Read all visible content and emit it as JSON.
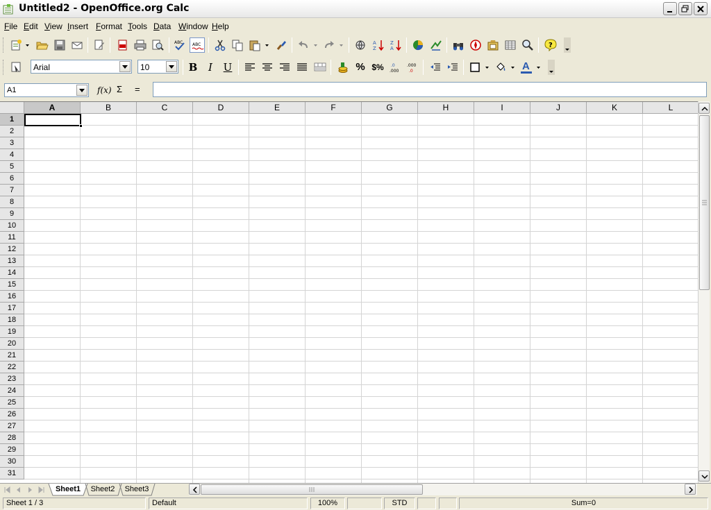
{
  "window": {
    "title": "Untitled2 - OpenOffice.org Calc"
  },
  "menu": [
    {
      "u": "F",
      "rest": "ile"
    },
    {
      "u": "E",
      "rest": "dit"
    },
    {
      "u": "V",
      "rest": "iew"
    },
    {
      "u": "I",
      "rest": "nsert"
    },
    {
      "u": "F",
      "rest": "ormat"
    },
    {
      "u": "T",
      "rest": "ools"
    },
    {
      "u": "D",
      "rest": "ata"
    },
    {
      "u": "W",
      "rest": "indow"
    },
    {
      "u": "H",
      "rest": "elp"
    }
  ],
  "format_toolbar": {
    "font_name": "Arial",
    "font_size": "10",
    "bold": "B",
    "italic": "I",
    "underline": "U",
    "percent": "%",
    "currency": "$%",
    "font_color_letter": "A"
  },
  "formula_bar": {
    "cell_ref": "A1",
    "function_label": "f(x)",
    "sum_label": "Σ",
    "equals_label": "=",
    "formula": ""
  },
  "grid": {
    "columns": [
      "A",
      "B",
      "C",
      "D",
      "E",
      "F",
      "G",
      "H",
      "I",
      "J",
      "K",
      "L"
    ],
    "rows": [
      "1",
      "2",
      "3",
      "4",
      "5",
      "6",
      "7",
      "8",
      "9",
      "10",
      "11",
      "12",
      "13",
      "14",
      "15",
      "16",
      "17",
      "18",
      "19",
      "20",
      "21",
      "22",
      "23",
      "24",
      "25",
      "26",
      "27",
      "28",
      "29",
      "30",
      "31"
    ],
    "selected_column": "A",
    "selected_row": "1"
  },
  "sheets": {
    "tabs": [
      "Sheet1",
      "Sheet2",
      "Sheet3"
    ],
    "active": "Sheet1"
  },
  "status": {
    "sheet": "Sheet 1 / 3",
    "page_style": "Default",
    "zoom": "100%",
    "mode": "STD",
    "sum": "Sum=0"
  },
  "colors": {
    "chrome": "#ece9d8",
    "header_bg": "#e6e6e6",
    "gridline": "#d4d4d4"
  }
}
